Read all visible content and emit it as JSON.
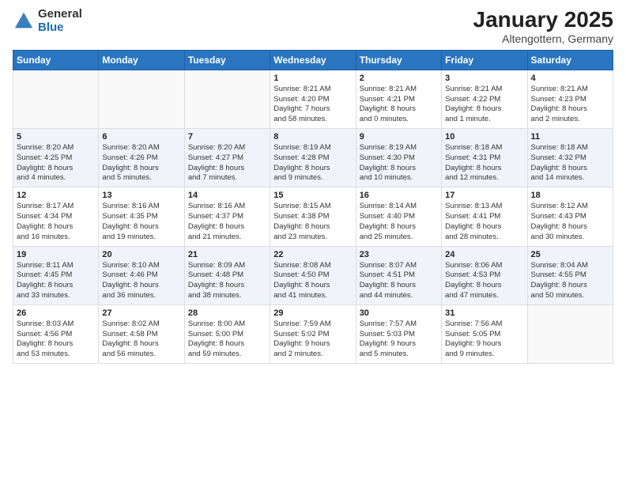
{
  "header": {
    "logo_general": "General",
    "logo_blue": "Blue",
    "title": "January 2025",
    "subtitle": "Altengottern, Germany"
  },
  "days_of_week": [
    "Sunday",
    "Monday",
    "Tuesday",
    "Wednesday",
    "Thursday",
    "Friday",
    "Saturday"
  ],
  "weeks": [
    [
      {
        "day": "",
        "info": ""
      },
      {
        "day": "",
        "info": ""
      },
      {
        "day": "",
        "info": ""
      },
      {
        "day": "1",
        "info": "Sunrise: 8:21 AM\nSunset: 4:20 PM\nDaylight: 7 hours\nand 58 minutes."
      },
      {
        "day": "2",
        "info": "Sunrise: 8:21 AM\nSunset: 4:21 PM\nDaylight: 8 hours\nand 0 minutes."
      },
      {
        "day": "3",
        "info": "Sunrise: 8:21 AM\nSunset: 4:22 PM\nDaylight: 8 hours\nand 1 minute."
      },
      {
        "day": "4",
        "info": "Sunrise: 8:21 AM\nSunset: 4:23 PM\nDaylight: 8 hours\nand 2 minutes."
      }
    ],
    [
      {
        "day": "5",
        "info": "Sunrise: 8:20 AM\nSunset: 4:25 PM\nDaylight: 8 hours\nand 4 minutes."
      },
      {
        "day": "6",
        "info": "Sunrise: 8:20 AM\nSunset: 4:26 PM\nDaylight: 8 hours\nand 5 minutes."
      },
      {
        "day": "7",
        "info": "Sunrise: 8:20 AM\nSunset: 4:27 PM\nDaylight: 8 hours\nand 7 minutes."
      },
      {
        "day": "8",
        "info": "Sunrise: 8:19 AM\nSunset: 4:28 PM\nDaylight: 8 hours\nand 9 minutes."
      },
      {
        "day": "9",
        "info": "Sunrise: 8:19 AM\nSunset: 4:30 PM\nDaylight: 8 hours\nand 10 minutes."
      },
      {
        "day": "10",
        "info": "Sunrise: 8:18 AM\nSunset: 4:31 PM\nDaylight: 8 hours\nand 12 minutes."
      },
      {
        "day": "11",
        "info": "Sunrise: 8:18 AM\nSunset: 4:32 PM\nDaylight: 8 hours\nand 14 minutes."
      }
    ],
    [
      {
        "day": "12",
        "info": "Sunrise: 8:17 AM\nSunset: 4:34 PM\nDaylight: 8 hours\nand 16 minutes."
      },
      {
        "day": "13",
        "info": "Sunrise: 8:16 AM\nSunset: 4:35 PM\nDaylight: 8 hours\nand 19 minutes."
      },
      {
        "day": "14",
        "info": "Sunrise: 8:16 AM\nSunset: 4:37 PM\nDaylight: 8 hours\nand 21 minutes."
      },
      {
        "day": "15",
        "info": "Sunrise: 8:15 AM\nSunset: 4:38 PM\nDaylight: 8 hours\nand 23 minutes."
      },
      {
        "day": "16",
        "info": "Sunrise: 8:14 AM\nSunset: 4:40 PM\nDaylight: 8 hours\nand 25 minutes."
      },
      {
        "day": "17",
        "info": "Sunrise: 8:13 AM\nSunset: 4:41 PM\nDaylight: 8 hours\nand 28 minutes."
      },
      {
        "day": "18",
        "info": "Sunrise: 8:12 AM\nSunset: 4:43 PM\nDaylight: 8 hours\nand 30 minutes."
      }
    ],
    [
      {
        "day": "19",
        "info": "Sunrise: 8:11 AM\nSunset: 4:45 PM\nDaylight: 8 hours\nand 33 minutes."
      },
      {
        "day": "20",
        "info": "Sunrise: 8:10 AM\nSunset: 4:46 PM\nDaylight: 8 hours\nand 36 minutes."
      },
      {
        "day": "21",
        "info": "Sunrise: 8:09 AM\nSunset: 4:48 PM\nDaylight: 8 hours\nand 38 minutes."
      },
      {
        "day": "22",
        "info": "Sunrise: 8:08 AM\nSunset: 4:50 PM\nDaylight: 8 hours\nand 41 minutes."
      },
      {
        "day": "23",
        "info": "Sunrise: 8:07 AM\nSunset: 4:51 PM\nDaylight: 8 hours\nand 44 minutes."
      },
      {
        "day": "24",
        "info": "Sunrise: 8:06 AM\nSunset: 4:53 PM\nDaylight: 8 hours\nand 47 minutes."
      },
      {
        "day": "25",
        "info": "Sunrise: 8:04 AM\nSunset: 4:55 PM\nDaylight: 8 hours\nand 50 minutes."
      }
    ],
    [
      {
        "day": "26",
        "info": "Sunrise: 8:03 AM\nSunset: 4:56 PM\nDaylight: 8 hours\nand 53 minutes."
      },
      {
        "day": "27",
        "info": "Sunrise: 8:02 AM\nSunset: 4:58 PM\nDaylight: 8 hours\nand 56 minutes."
      },
      {
        "day": "28",
        "info": "Sunrise: 8:00 AM\nSunset: 5:00 PM\nDaylight: 8 hours\nand 59 minutes."
      },
      {
        "day": "29",
        "info": "Sunrise: 7:59 AM\nSunset: 5:02 PM\nDaylight: 9 hours\nand 2 minutes."
      },
      {
        "day": "30",
        "info": "Sunrise: 7:57 AM\nSunset: 5:03 PM\nDaylight: 9 hours\nand 5 minutes."
      },
      {
        "day": "31",
        "info": "Sunrise: 7:56 AM\nSunset: 5:05 PM\nDaylight: 9 hours\nand 9 minutes."
      },
      {
        "day": "",
        "info": ""
      }
    ]
  ]
}
